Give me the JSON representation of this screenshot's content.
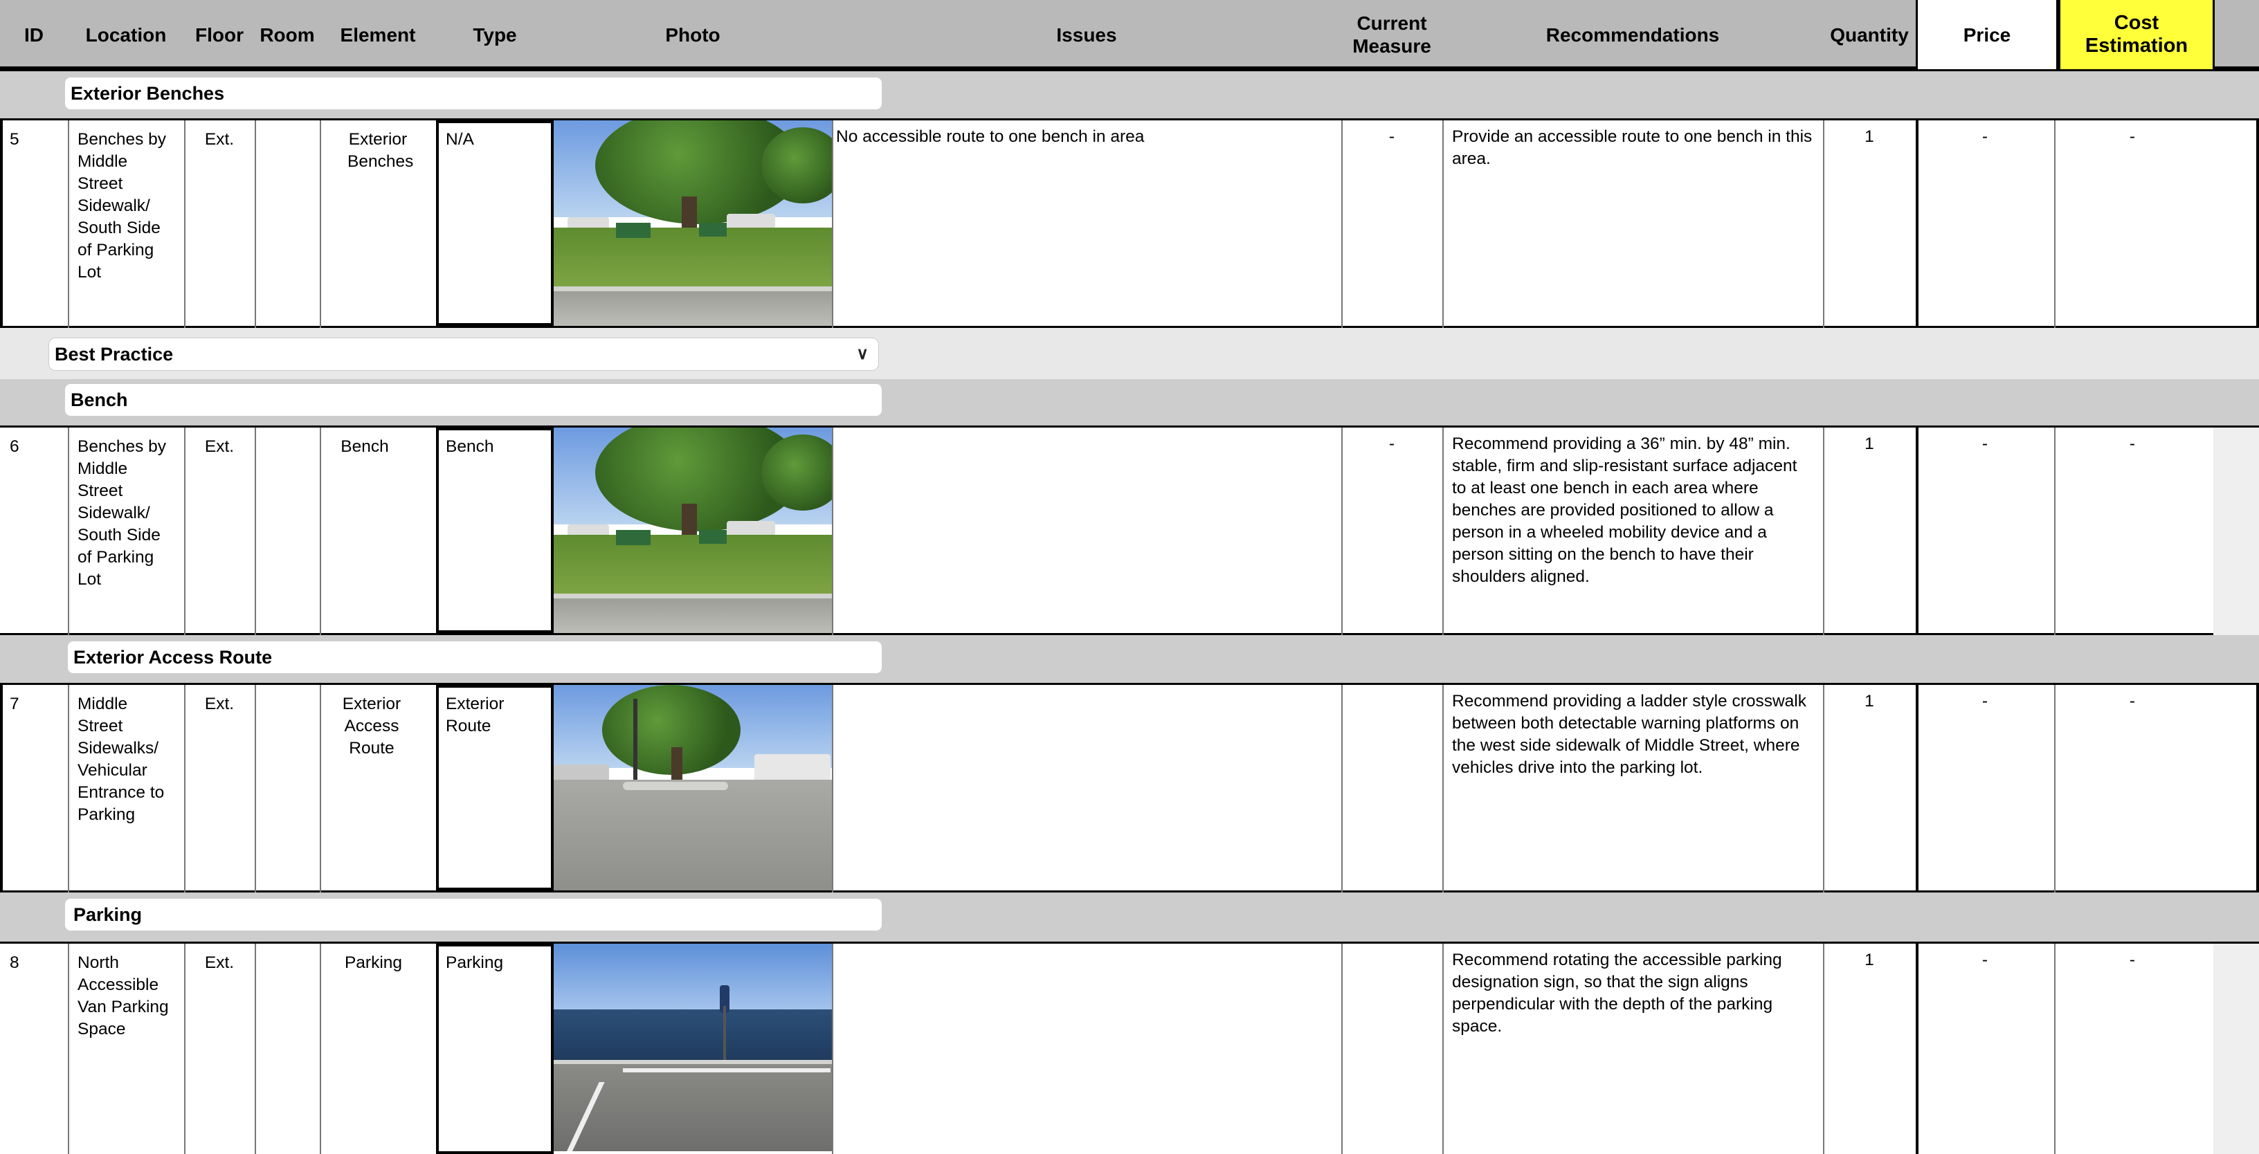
{
  "header": {
    "id": "ID",
    "location": "Location",
    "floor": "Floor",
    "room": "Room",
    "element": "Element",
    "type": "Type",
    "photo": "Photo",
    "issues": "Issues",
    "current_measure": "Current Measure",
    "recommendations": "Recommendations",
    "quantity": "Quantity",
    "price": "Price",
    "cost_estimation": "Cost Estimation"
  },
  "colors": {
    "header_bg": "#b9b9b9",
    "section_bg": "#cdcdcd",
    "cost_header_bg": "#ffff3a"
  },
  "sections": {
    "exterior_benches": "Exterior Benches",
    "best_practice": "Best Practice",
    "bench": "Bench",
    "exterior_access_route": "Exterior Access Route",
    "parking": "Parking"
  },
  "rows": [
    {
      "id": "5",
      "location": "Benches by Middle Street Sidewalk/ South Side of Parking Lot",
      "floor": "Ext.",
      "room": "",
      "element": "Exterior Benches",
      "type": "N/A",
      "photo": "tree-and-benches-photo",
      "issues": "No accessible route to one bench in area",
      "current_measure": "-",
      "recommendations": "Provide an accessible route to one bench in this area.",
      "quantity": "1",
      "price": "-",
      "cost": "-"
    },
    {
      "id": "6",
      "location": "Benches by Middle Street Sidewalk/ South Side of Parking Lot",
      "floor": "Ext.",
      "room": "",
      "element": "Bench",
      "type": "Bench",
      "photo": "tree-and-benches-photo",
      "issues": "",
      "current_measure": "-",
      "recommendations": "Recommend providing a 36” min. by 48” min. stable, firm and slip-resistant surface adjacent to at least one bench in each area where benches are provided positioned to allow a person in a wheeled mobility device and a person sitting on the bench to have their shoulders aligned.",
      "quantity": "1",
      "price": "-",
      "cost": "-"
    },
    {
      "id": "7",
      "location": "Middle Street Sidewalks/ Vehicular Entrance to Parking",
      "floor": "Ext.",
      "room": "",
      "element": "Exterior Access Route",
      "type": "Exterior Route",
      "photo": "parking-entrance-photo",
      "issues": "",
      "current_measure": "",
      "recommendations": "Recommend providing a ladder style crosswalk between both detectable warning platforms on the west side sidewalk of Middle Street, where vehicles drive into the parking lot.",
      "quantity": "1",
      "price": "-",
      "cost": "-"
    },
    {
      "id": "8",
      "location": "North Accessible Van Parking Space",
      "floor": "Ext.",
      "room": "",
      "element": "Parking",
      "type": "Parking",
      "photo": "waterfront-parking-photo",
      "issues": "",
      "current_measure": "",
      "recommendations": "Recommend rotating the accessible parking designation sign, so that the sign aligns perpendicular with the depth of the parking space.",
      "quantity": "1",
      "price": "-",
      "cost": "-"
    }
  ]
}
